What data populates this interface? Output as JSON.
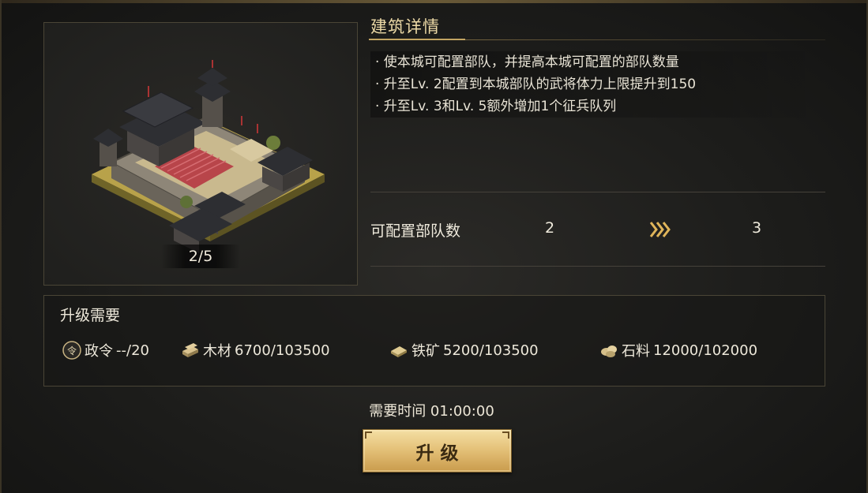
{
  "building": {
    "level": "2/5"
  },
  "details": {
    "title": "建筑详情",
    "bullets": [
      "· 使本城可配置部队，并提高本城可配置的部队数量",
      "· 升至Lv. 2配置到本城部队的武将体力上限提升到150",
      "· 升至Lv. 3和Lv. 5额外增加1个征兵队列"
    ],
    "capacity": {
      "label": "可配置部队数",
      "current": "2",
      "next": "3"
    }
  },
  "requirements": {
    "title": "升级需要",
    "items": [
      {
        "icon": "decree-icon",
        "name": "政令",
        "have": "--",
        "need": "/20"
      },
      {
        "icon": "wood-icon",
        "name": "木材",
        "have": "6700",
        "need": "/103500"
      },
      {
        "icon": "iron-icon",
        "name": "铁矿",
        "have": "5200",
        "need": "/103500"
      },
      {
        "icon": "stone-icon",
        "name": "石料",
        "have": "12000",
        "need": "/102000"
      }
    ]
  },
  "time": {
    "text": "需要时间 01:00:00"
  },
  "upgrade_button": {
    "label": "升级"
  },
  "colors": {
    "accent_gold": "#e5c27a",
    "title_gold": "#ecd9a6",
    "panel_border": "#4a4536"
  }
}
